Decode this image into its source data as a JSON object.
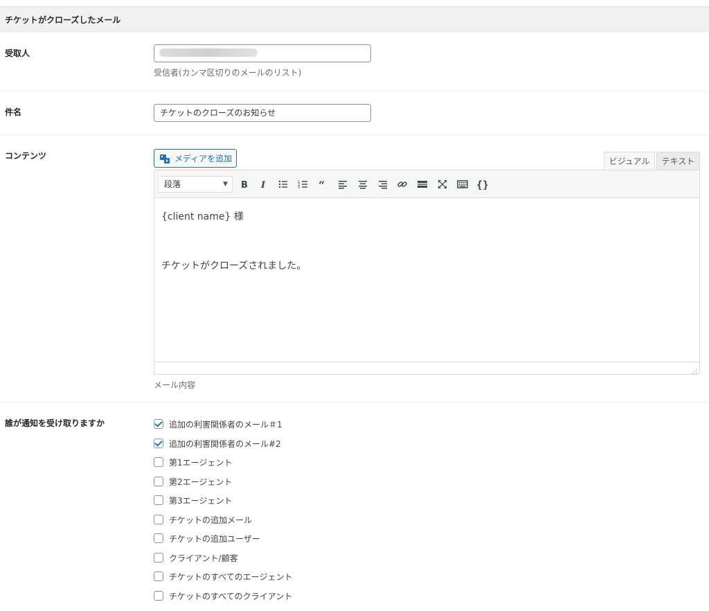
{
  "section": {
    "title": "チケットがクローズしたメール"
  },
  "recipient": {
    "label": "受取人",
    "value": "",
    "help": "受信者(カンマ区切りのメールのリスト)"
  },
  "subject": {
    "label": "件名",
    "value": "チケットのクローズのお知らせ"
  },
  "content": {
    "label": "コンテンツ",
    "add_media_label": "メディアを追加",
    "tabs": {
      "visual": "ビジュアル",
      "text": "テキスト"
    },
    "format_select": "段落",
    "toolbar_icons": [
      "bold-icon",
      "italic-icon",
      "bullet-list-icon",
      "numbered-list-icon",
      "blockquote-icon",
      "align-left-icon",
      "align-center-icon",
      "align-right-icon",
      "link-icon",
      "read-more-icon",
      "fullscreen-icon",
      "toolbar-toggle-icon",
      "shortcode-braces-icon"
    ],
    "body_lines": [
      "{client name} 様",
      "チケットがクローズされました。"
    ],
    "help": "メール内容"
  },
  "notify": {
    "label": "誰が通知を受け取りますか",
    "options": [
      {
        "label": "追加の利害関係者のメール＃1",
        "checked": true
      },
      {
        "label": "追加の利害関係者のメール#2",
        "checked": true
      },
      {
        "label": "第1エージェント",
        "checked": false
      },
      {
        "label": "第2エージェント",
        "checked": false
      },
      {
        "label": "第3エージェント",
        "checked": false
      },
      {
        "label": "チケットの追加メール",
        "checked": false
      },
      {
        "label": "チケットの追加ユーザー",
        "checked": false
      },
      {
        "label": "クライアント/顧客",
        "checked": false
      },
      {
        "label": "チケットのすべてのエージェント",
        "checked": false
      },
      {
        "label": "チケットのすべてのクライアント",
        "checked": false
      }
    ]
  },
  "colors": {
    "accent": "#2271b1",
    "header_bg": "#f1f1f1",
    "text": "#23282d"
  }
}
